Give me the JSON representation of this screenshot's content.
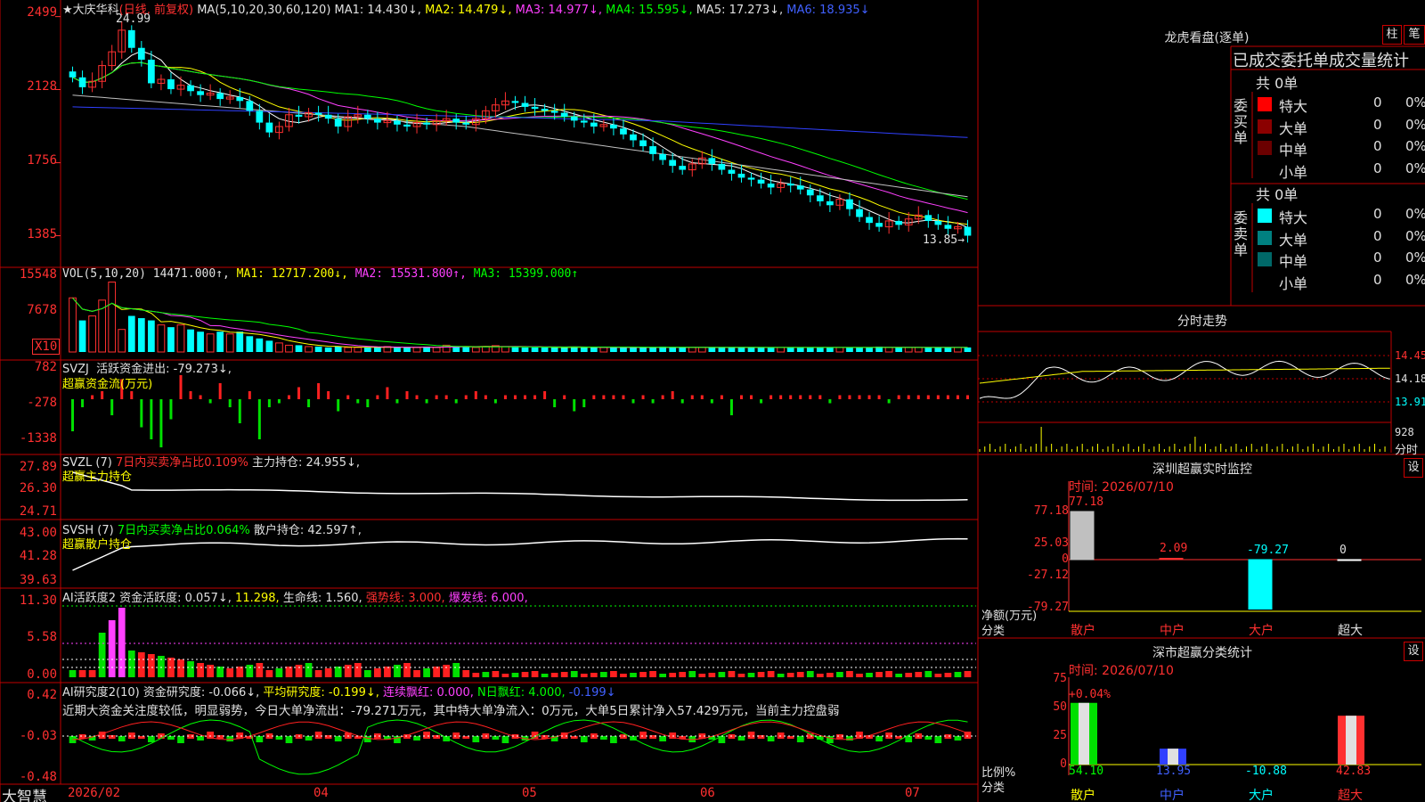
{
  "header": {
    "stock_name": "★大庆华科",
    "mode": "(日线, 前复权)",
    "ma_label": "MA(5,10,20,30,60,120)",
    "ma1": "MA1: 14.430↓,",
    "ma2": "MA2: 14.479↓,",
    "ma3": "MA3: 14.977↓,",
    "ma4": "MA4: 15.595↓,",
    "ma5": "MA5: 17.273↓,",
    "ma6": "MA6: 18.935↓"
  },
  "price_panel": {
    "y_ticks": [
      "2499",
      "2128",
      "1756",
      "1385"
    ],
    "high_label": "24.99",
    "last_label": "13.85→"
  },
  "vol_panel": {
    "title": "VOL(5,10,20)",
    "value": "14471.000↑,",
    "ma1": "MA1: 12717.200↓,",
    "ma2": "MA2: 15531.800↑,",
    "ma3": "MA3: 15399.000↑",
    "y_ticks": [
      "15548",
      "7678"
    ],
    "unit": "X10"
  },
  "svzj_panel": {
    "title": "SVZJ",
    "label": "活跃资金进出: -79.273↓,",
    "sub": "超赢资金流(万元)",
    "y_ticks": [
      "782",
      "-278",
      "-1338"
    ]
  },
  "svzl_panel": {
    "title": "SVZL (7)",
    "ratio": "7日内买卖净占比0.109%",
    "label": "主力持仓: 24.955↓,",
    "sub": "超赢主力持仓",
    "y_ticks": [
      "27.89",
      "26.30",
      "24.71"
    ]
  },
  "svsh_panel": {
    "title": "SVSH (7)",
    "ratio": "7日内买卖净占比0.064%",
    "label": "散户持仓: 42.597↑,",
    "sub": "超赢散户持仓",
    "y_ticks": [
      "43.00",
      "41.28",
      "39.63"
    ]
  },
  "ai_act_panel": {
    "title": "AI活跃度2",
    "label": "资金活跃度: 0.057↓,",
    "v2": "11.298,",
    "life": "生命线: 1.560,",
    "strong": "强势线: 3.000,",
    "burst": "爆发线: 6.000,",
    "y_ticks": [
      "11.30",
      "5.58",
      "0.00"
    ]
  },
  "ai_res_panel": {
    "title": "AI研究度2(10)",
    "label": "资金研究度: -0.066↓,",
    "avg": "平均研究度: -0.199↓,",
    "red": "连续飘红: 0.000,",
    "nred": "N日飘红: 4.000,",
    "last": "-0.199↓",
    "comment": "近期大资金关注度较低，明显弱势，今日大单净流出：-79.271万元，其中特大单净流入：0万元，大单5日累计净入57.429万元，当前主力控盘弱",
    "y_ticks": [
      "0.42",
      "-0.03",
      "-0.48"
    ]
  },
  "x_axis": {
    "brand": "大智慧",
    "labels": [
      "2026/02",
      "04",
      "05",
      "06",
      "07"
    ]
  },
  "right": {
    "dragon_title": "龙虎看盘(逐单)",
    "btn1": "柱",
    "btn2": "笔",
    "stat_title": "已成交委托单成交量统计",
    "buy_total": "共 0单",
    "sell_total": "共 0单",
    "buy_side": "委买单",
    "sell_side": "委卖单",
    "buy_rows": [
      {
        "name": "特大",
        "v": "0",
        "p": "0%"
      },
      {
        "name": "大单",
        "v": "0",
        "p": "0%"
      },
      {
        "name": "中单",
        "v": "0",
        "p": "0%"
      },
      {
        "name": "小单",
        "v": "0",
        "p": "0%"
      }
    ],
    "sell_rows": [
      {
        "name": "特大",
        "v": "0",
        "p": "0%"
      },
      {
        "name": "大单",
        "v": "0",
        "p": "0%"
      },
      {
        "name": "中单",
        "v": "0",
        "p": "0%"
      },
      {
        "name": "小单",
        "v": "0",
        "p": "0%"
      }
    ],
    "intraday_title": "分时走势",
    "intraday_ticks": [
      "14.45",
      "14.18",
      "13.91"
    ],
    "intraday_vol": "928",
    "intraday_unit": "分时",
    "monitor_title": "深圳超赢实时监控",
    "monitor_btn": "设",
    "monitor_time": "时间: 2026/07/10",
    "monitor_ticks": [
      "77.18",
      "25.03",
      "0",
      "-27.12",
      "-79.27"
    ],
    "monitor_values": [
      "77.18",
      "2.09",
      "-79.27",
      "0"
    ],
    "monitor_ylabel": "净额(万元)",
    "monitor_xlabel": "分类",
    "monitor_cats": [
      "散户",
      "中户",
      "大户",
      "超大"
    ],
    "class_title": "深市超赢分类统计",
    "class_btn": "设",
    "class_time": "时间: 2026/07/10",
    "class_ticks": [
      "75",
      "50",
      "25",
      "0"
    ],
    "class_top": "+0.04%",
    "class_values": [
      "54.10",
      "13.95",
      "-10.88",
      "42.83"
    ],
    "class_ylabel": "比例%",
    "class_xlabel": "分类",
    "class_cats": [
      "散户",
      "中户",
      "大户",
      "超大"
    ]
  },
  "colors": {
    "up": "#ff3030",
    "down": "#00ffff",
    "grid": "#c00000",
    "ma1": "#ffffff",
    "ma2": "#ffff00",
    "ma3": "#ff40ff",
    "ma4": "#00ff00",
    "ma5": "#c0c0c0",
    "ma6": "#3040ff"
  },
  "chart_data": {
    "type": "candlestick",
    "title": "★大庆华科",
    "x_labels": [
      "2026/02",
      "04",
      "05",
      "06",
      "07"
    ],
    "ylim": [
      13.6,
      25.2
    ],
    "last": 13.85,
    "high": 24.99,
    "close_series": [
      21.9,
      21.4,
      21.7,
      22.5,
      23.2,
      24.3,
      23.4,
      22.8,
      21.6,
      21.8,
      21.3,
      21.5,
      21.2,
      21.0,
      21.1,
      20.8,
      20.9,
      20.7,
      20.2,
      19.6,
      19.1,
      19.4,
      20.0,
      19.9,
      20.1,
      20.0,
      19.8,
      19.4,
      19.9,
      20.0,
      19.8,
      19.6,
      19.7,
      19.5,
      19.4,
      19.6,
      19.5,
      19.7,
      19.8,
      19.6,
      19.5,
      19.8,
      20.2,
      20.5,
      20.7,
      20.6,
      20.4,
      20.3,
      20.2,
      20.1,
      19.9,
      19.7,
      19.6,
      19.4,
      19.5,
      19.3,
      19.0,
      18.7,
      18.4,
      18.0,
      17.7,
      17.4,
      17.2,
      17.5,
      17.8,
      17.5,
      17.2,
      17.0,
      16.8,
      16.7,
      16.5,
      16.3,
      16.5,
      16.4,
      16.2,
      15.9,
      15.6,
      15.4,
      15.7,
      15.2,
      14.8,
      14.5,
      14.3,
      14.6,
      14.4,
      14.7,
      14.9,
      14.6,
      14.4,
      14.2,
      14.3,
      13.85
    ],
    "vol_series": [
      120,
      70,
      80,
      115,
      155,
      50,
      80,
      75,
      70,
      60,
      55,
      60,
      50,
      45,
      40,
      45,
      40,
      45,
      35,
      30,
      25,
      20,
      15,
      15,
      12,
      12,
      10,
      12,
      10,
      10,
      10,
      10,
      12,
      10,
      10,
      10,
      12,
      10,
      15,
      12,
      12,
      10,
      12,
      14,
      12,
      12,
      10,
      10,
      10,
      10,
      10,
      12,
      10,
      10,
      10,
      10,
      10,
      10,
      10,
      10,
      12,
      10,
      10,
      10,
      10,
      10,
      10,
      10,
      10,
      10,
      10,
      10,
      10,
      10,
      10,
      10,
      10,
      10,
      10,
      10,
      10,
      10,
      12,
      10,
      10,
      10,
      10,
      10,
      10,
      10,
      10,
      10
    ],
    "flow_series": [
      -40,
      -10,
      5,
      10,
      -20,
      25,
      10,
      -35,
      -50,
      -60,
      -25,
      30,
      10,
      5,
      -5,
      20,
      -10,
      -30,
      10,
      -50,
      -10,
      -5,
      5,
      15,
      -10,
      20,
      10,
      -15,
      5,
      -5,
      -10,
      5,
      15,
      -5,
      10,
      5,
      -5,
      5,
      5,
      -5,
      5,
      10,
      5,
      -5,
      5,
      5,
      5,
      5,
      10,
      -10,
      5,
      -15,
      -10,
      5,
      5,
      5,
      5,
      -5,
      5,
      -5,
      5,
      10,
      -5,
      5,
      5,
      -5,
      5,
      -20,
      5,
      5,
      -5,
      5,
      5,
      5,
      5,
      5,
      5,
      -5,
      5,
      5,
      5,
      5,
      5,
      -5,
      5,
      5,
      5,
      5,
      5,
      5,
      5,
      5
    ]
  }
}
